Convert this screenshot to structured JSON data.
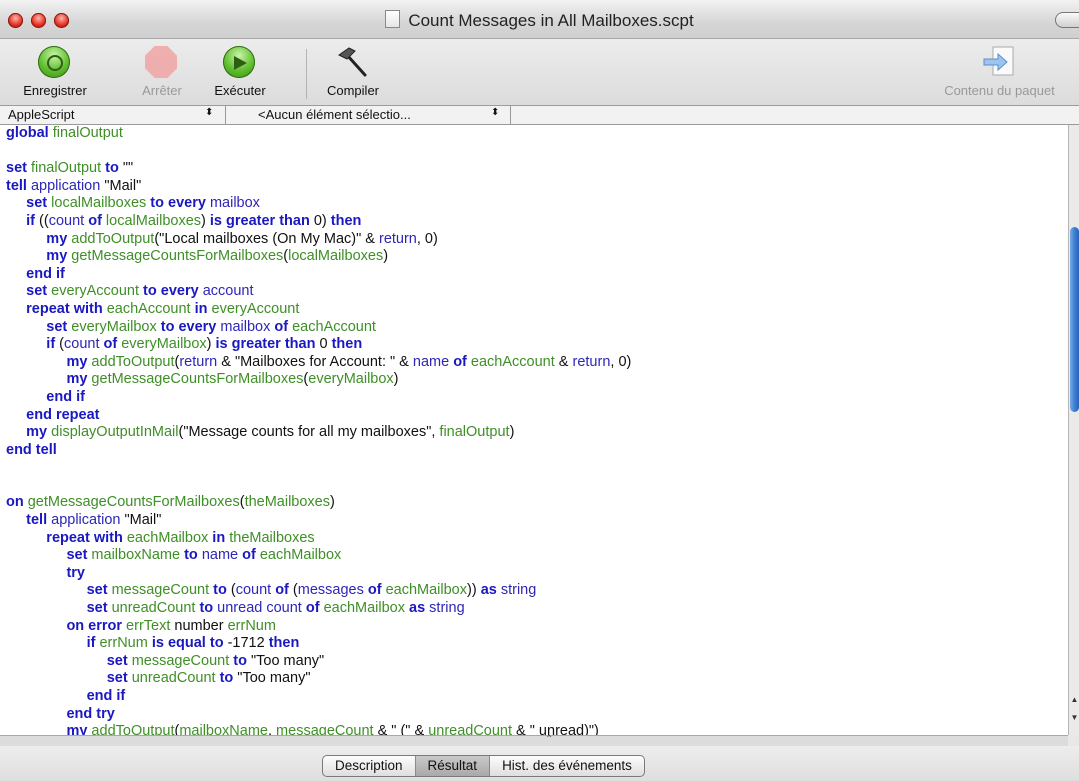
{
  "window": {
    "title": "Count Messages in All Mailboxes.scpt"
  },
  "toolbar": {
    "record_label": "Enregistrer",
    "stop_label": "Arrêter",
    "run_label": "Exécuter",
    "compile_label": "Compiler",
    "bundle_label": "Contenu du paquet"
  },
  "popups": {
    "language": "AppleScript",
    "element": "<Aucun élément sélectio..."
  },
  "tabs": {
    "description": "Description",
    "result": "Résultat",
    "events": "Hist. des événements"
  },
  "code_lines": [
    [
      [
        "k",
        "global"
      ],
      [
        "i",
        " finalOutput"
      ]
    ],
    [],
    [
      [
        "k",
        "set"
      ],
      [
        "i",
        " finalOutput"
      ],
      [
        "k",
        " to"
      ],
      [
        "p",
        " \"\""
      ]
    ],
    [
      [
        "k",
        "tell"
      ],
      [
        "a",
        " application"
      ],
      [
        "p",
        " \"Mail\""
      ]
    ],
    [
      [
        "p",
        "     "
      ],
      [
        "k",
        "set"
      ],
      [
        "i",
        " localMailboxes"
      ],
      [
        "k",
        " to every"
      ],
      [
        "a",
        " mailbox"
      ]
    ],
    [
      [
        "p",
        "     "
      ],
      [
        "k",
        "if"
      ],
      [
        "p",
        " (("
      ],
      [
        "a",
        "count"
      ],
      [
        "k",
        " of"
      ],
      [
        "i",
        " localMailboxes"
      ],
      [
        "p",
        ") "
      ],
      [
        "k",
        "is greater than"
      ],
      [
        "p",
        " 0) "
      ],
      [
        "k",
        "then"
      ]
    ],
    [
      [
        "p",
        "          "
      ],
      [
        "k",
        "my"
      ],
      [
        "i",
        " addToOutput"
      ],
      [
        "p",
        "(\"Local mailboxes (On My Mac)\" & "
      ],
      [
        "a",
        "return"
      ],
      [
        "p",
        ", 0)"
      ]
    ],
    [
      [
        "p",
        "          "
      ],
      [
        "k",
        "my"
      ],
      [
        "i",
        " getMessageCountsForMailboxes"
      ],
      [
        "p",
        "("
      ],
      [
        "i",
        "localMailboxes"
      ],
      [
        "p",
        ")"
      ]
    ],
    [
      [
        "p",
        "     "
      ],
      [
        "k",
        "end if"
      ]
    ],
    [
      [
        "p",
        "     "
      ],
      [
        "k",
        "set"
      ],
      [
        "i",
        " everyAccount"
      ],
      [
        "k",
        " to every"
      ],
      [
        "a",
        " account"
      ]
    ],
    [
      [
        "p",
        "     "
      ],
      [
        "k",
        "repeat with"
      ],
      [
        "i",
        " eachAccount"
      ],
      [
        "k",
        " in"
      ],
      [
        "i",
        " everyAccount"
      ]
    ],
    [
      [
        "p",
        "          "
      ],
      [
        "k",
        "set"
      ],
      [
        "i",
        " everyMailbox"
      ],
      [
        "k",
        " to every"
      ],
      [
        "a",
        " mailbox"
      ],
      [
        "k",
        " of"
      ],
      [
        "i",
        " eachAccount"
      ]
    ],
    [
      [
        "p",
        "          "
      ],
      [
        "k",
        "if"
      ],
      [
        "p",
        " ("
      ],
      [
        "a",
        "count"
      ],
      [
        "k",
        " of"
      ],
      [
        "i",
        " everyMailbox"
      ],
      [
        "p",
        ") "
      ],
      [
        "k",
        "is greater than"
      ],
      [
        "p",
        " 0 "
      ],
      [
        "k",
        "then"
      ]
    ],
    [
      [
        "p",
        "               "
      ],
      [
        "k",
        "my"
      ],
      [
        "i",
        " addToOutput"
      ],
      [
        "p",
        "("
      ],
      [
        "a",
        "return"
      ],
      [
        "p",
        " & \"Mailboxes for Account: \" & "
      ],
      [
        "a",
        "name"
      ],
      [
        "k",
        " of"
      ],
      [
        "i",
        " eachAccount"
      ],
      [
        "p",
        " & "
      ],
      [
        "a",
        "return"
      ],
      [
        "p",
        ", 0)"
      ]
    ],
    [
      [
        "p",
        "               "
      ],
      [
        "k",
        "my"
      ],
      [
        "i",
        " getMessageCountsForMailboxes"
      ],
      [
        "p",
        "("
      ],
      [
        "i",
        "everyMailbox"
      ],
      [
        "p",
        ")"
      ]
    ],
    [
      [
        "p",
        "          "
      ],
      [
        "k",
        "end if"
      ]
    ],
    [
      [
        "p",
        "     "
      ],
      [
        "k",
        "end repeat"
      ]
    ],
    [
      [
        "p",
        "     "
      ],
      [
        "k",
        "my"
      ],
      [
        "i",
        " displayOutputInMail"
      ],
      [
        "p",
        "(\"Message counts for all my mailboxes\", "
      ],
      [
        "i",
        "finalOutput"
      ],
      [
        "p",
        ")"
      ]
    ],
    [
      [
        "k",
        "end tell"
      ]
    ],
    [],
    [],
    [
      [
        "k",
        "on"
      ],
      [
        "i",
        " getMessageCountsForMailboxes"
      ],
      [
        "p",
        "("
      ],
      [
        "i",
        "theMailboxes"
      ],
      [
        "p",
        ")"
      ]
    ],
    [
      [
        "p",
        "     "
      ],
      [
        "k",
        "tell"
      ],
      [
        "a",
        " application"
      ],
      [
        "p",
        " \"Mail\""
      ]
    ],
    [
      [
        "p",
        "          "
      ],
      [
        "k",
        "repeat with"
      ],
      [
        "i",
        " eachMailbox"
      ],
      [
        "k",
        " in"
      ],
      [
        "i",
        " theMailboxes"
      ]
    ],
    [
      [
        "p",
        "               "
      ],
      [
        "k",
        "set"
      ],
      [
        "i",
        " mailboxName"
      ],
      [
        "k",
        " to"
      ],
      [
        "a",
        " name"
      ],
      [
        "k",
        " of"
      ],
      [
        "i",
        " eachMailbox"
      ]
    ],
    [
      [
        "p",
        "               "
      ],
      [
        "k",
        "try"
      ]
    ],
    [
      [
        "p",
        "                    "
      ],
      [
        "k",
        "set"
      ],
      [
        "i",
        " messageCount"
      ],
      [
        "k",
        " to"
      ],
      [
        "p",
        " ("
      ],
      [
        "a",
        "count"
      ],
      [
        "k",
        " of"
      ],
      [
        "p",
        " ("
      ],
      [
        "a",
        "messages"
      ],
      [
        "k",
        " of"
      ],
      [
        "i",
        " eachMailbox"
      ],
      [
        "p",
        ")) "
      ],
      [
        "k",
        "as"
      ],
      [
        "a",
        " string"
      ]
    ],
    [
      [
        "p",
        "                    "
      ],
      [
        "k",
        "set"
      ],
      [
        "i",
        " unreadCount"
      ],
      [
        "k",
        " to"
      ],
      [
        "a",
        " unread count"
      ],
      [
        "k",
        " of"
      ],
      [
        "i",
        " eachMailbox"
      ],
      [
        "k",
        " as"
      ],
      [
        "a",
        " string"
      ]
    ],
    [
      [
        "p",
        "               "
      ],
      [
        "k",
        "on error"
      ],
      [
        "i",
        " errText"
      ],
      [
        "p",
        " number "
      ],
      [
        "i",
        "errNum"
      ]
    ],
    [
      [
        "p",
        "                    "
      ],
      [
        "k",
        "if"
      ],
      [
        "i",
        " errNum"
      ],
      [
        "k",
        " is equal to"
      ],
      [
        "p",
        " -1712 "
      ],
      [
        "k",
        "then"
      ]
    ],
    [
      [
        "p",
        "                         "
      ],
      [
        "k",
        "set"
      ],
      [
        "i",
        " messageCount"
      ],
      [
        "k",
        " to"
      ],
      [
        "p",
        " \"Too many\""
      ]
    ],
    [
      [
        "p",
        "                         "
      ],
      [
        "k",
        "set"
      ],
      [
        "i",
        " unreadCount"
      ],
      [
        "k",
        " to"
      ],
      [
        "p",
        " \"Too many\""
      ]
    ],
    [
      [
        "p",
        "                    "
      ],
      [
        "k",
        "end if"
      ]
    ],
    [
      [
        "p",
        "               "
      ],
      [
        "k",
        "end try"
      ]
    ],
    [
      [
        "p",
        "               "
      ],
      [
        "k",
        "my"
      ],
      [
        "i",
        " addToOutput"
      ],
      [
        "p",
        "("
      ],
      [
        "i",
        "mailboxName"
      ],
      [
        "p",
        ", "
      ],
      [
        "i",
        "messageCount"
      ],
      [
        "p",
        " & \" (\" & "
      ],
      [
        "i",
        "unreadCount"
      ],
      [
        "p",
        " & \" unread)\")"
      ]
    ]
  ]
}
